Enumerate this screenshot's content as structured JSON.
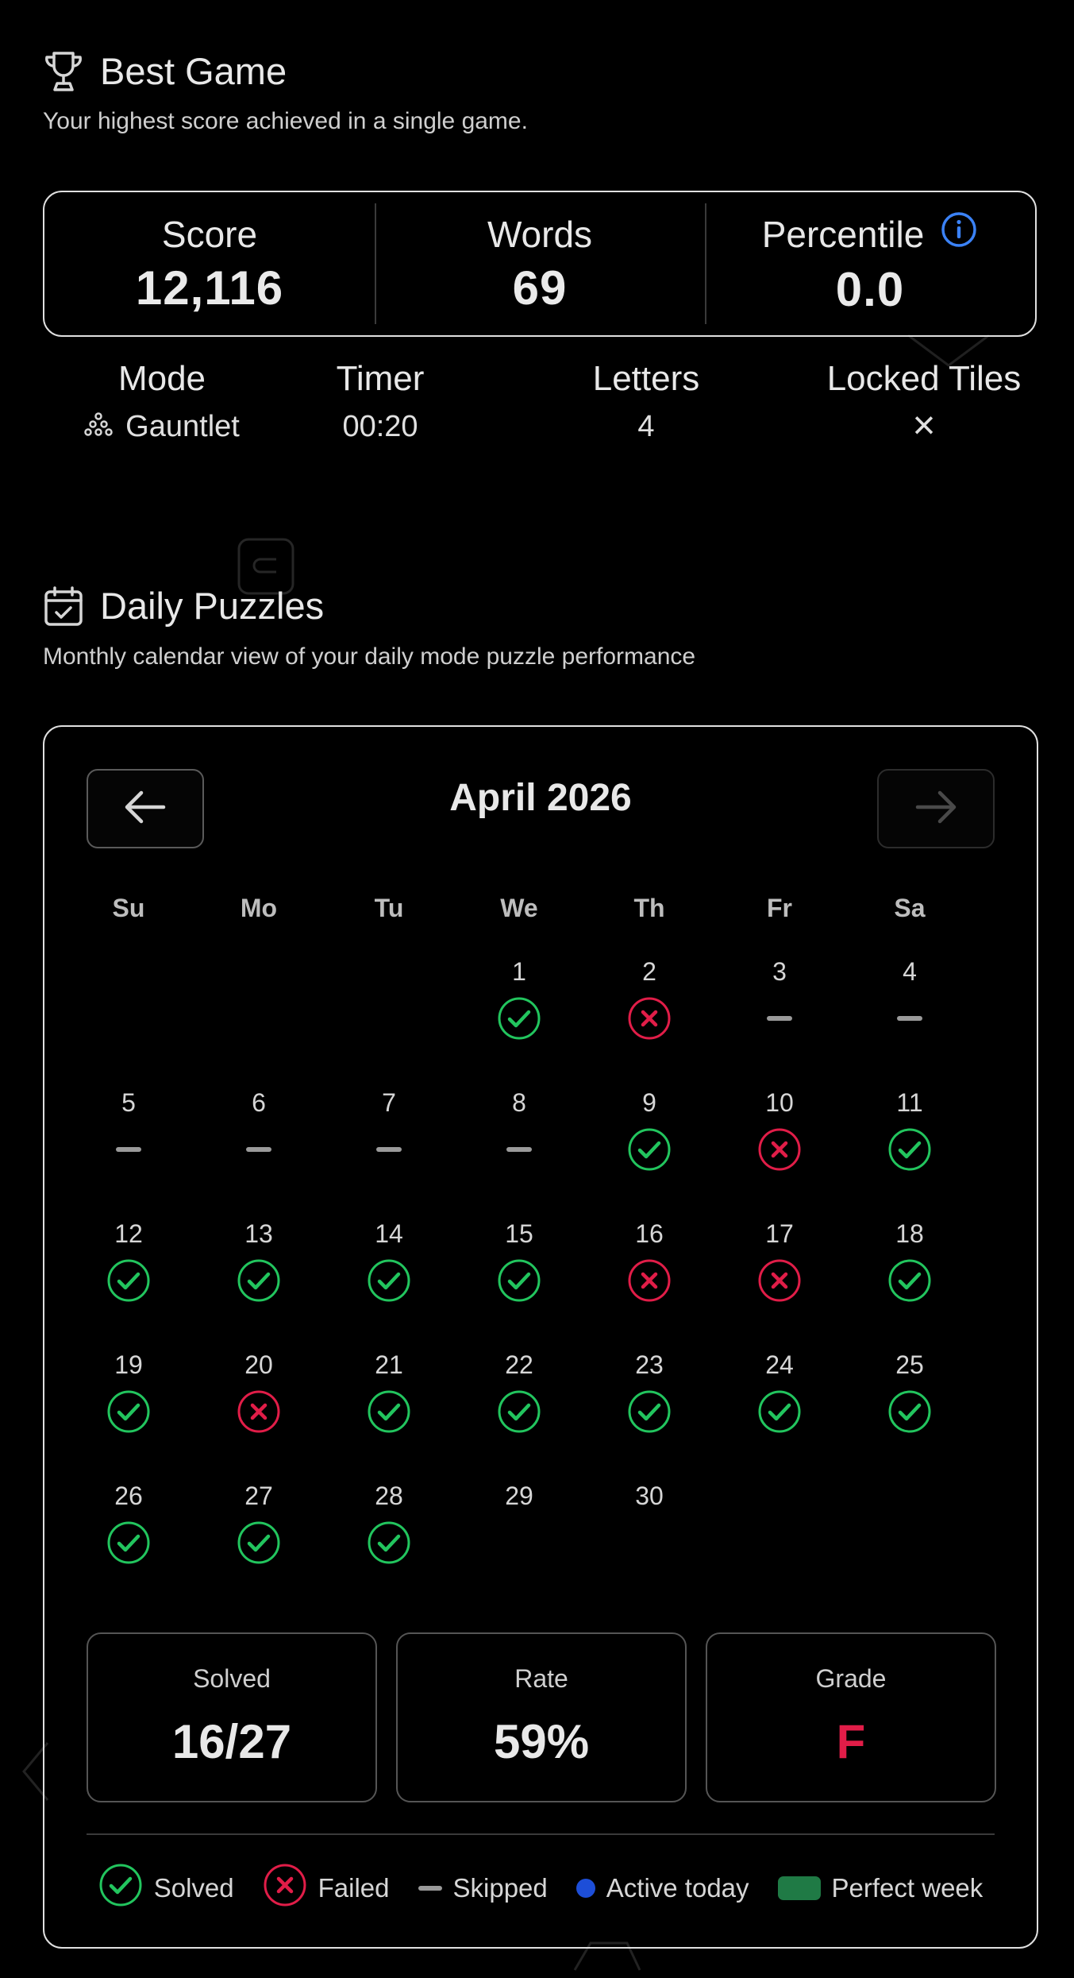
{
  "best_game": {
    "title": "Best Game",
    "subtitle": "Your highest score achieved in a single game.",
    "stats": [
      {
        "label": "Score",
        "value": "12,116"
      },
      {
        "label": "Words",
        "value": "69"
      },
      {
        "label": "Percentile",
        "value": "0.0"
      }
    ],
    "meta": [
      {
        "label": "Mode",
        "value": "Gauntlet"
      },
      {
        "label": "Timer",
        "value": "00:20"
      },
      {
        "label": "Letters",
        "value": "4"
      },
      {
        "label": "Locked Tiles",
        "value": "×"
      }
    ]
  },
  "daily": {
    "title": "Daily Puzzles",
    "subtitle": "Monthly calendar view of your daily mode puzzle performance",
    "month": "April 2026",
    "weekdays": [
      "Su",
      "Mo",
      "Tu",
      "We",
      "Th",
      "Fr",
      "Sa"
    ],
    "first_weekday_index": 3,
    "days": [
      {
        "day": "1",
        "status": "solved"
      },
      {
        "day": "2",
        "status": "failed"
      },
      {
        "day": "3",
        "status": "skipped"
      },
      {
        "day": "4",
        "status": "skipped"
      },
      {
        "day": "5",
        "status": "skipped"
      },
      {
        "day": "6",
        "status": "skipped"
      },
      {
        "day": "7",
        "status": "skipped"
      },
      {
        "day": "8",
        "status": "skipped"
      },
      {
        "day": "9",
        "status": "solved"
      },
      {
        "day": "10",
        "status": "failed"
      },
      {
        "day": "11",
        "status": "solved"
      },
      {
        "day": "12",
        "status": "solved"
      },
      {
        "day": "13",
        "status": "solved"
      },
      {
        "day": "14",
        "status": "solved"
      },
      {
        "day": "15",
        "status": "solved"
      },
      {
        "day": "16",
        "status": "failed"
      },
      {
        "day": "17",
        "status": "failed"
      },
      {
        "day": "18",
        "status": "solved"
      },
      {
        "day": "19",
        "status": "solved"
      },
      {
        "day": "20",
        "status": "failed"
      },
      {
        "day": "21",
        "status": "solved"
      },
      {
        "day": "22",
        "status": "solved"
      },
      {
        "day": "23",
        "status": "solved"
      },
      {
        "day": "24",
        "status": "solved"
      },
      {
        "day": "25",
        "status": "solved"
      },
      {
        "day": "26",
        "status": "solved"
      },
      {
        "day": "27",
        "status": "solved"
      },
      {
        "day": "28",
        "status": "solved"
      },
      {
        "day": "29",
        "status": "none"
      },
      {
        "day": "30",
        "status": "none"
      }
    ],
    "summary": [
      {
        "label": "Solved",
        "value": "16/27"
      },
      {
        "label": "Rate",
        "value": "59%"
      },
      {
        "label": "Grade",
        "value": "F"
      }
    ],
    "legend": [
      {
        "label": "Solved",
        "icon": "check-circle-icon"
      },
      {
        "label": "Failed",
        "icon": "x-circle-icon"
      },
      {
        "label": "Skipped",
        "icon": "dash-icon"
      },
      {
        "label": "Active today",
        "icon": "blue-dot-icon"
      },
      {
        "label": "Perfect week",
        "icon": "green-rect-icon"
      }
    ]
  },
  "colors": {
    "solved": "#22c55e",
    "failed": "#e11d48",
    "skipped": "#9a9a9a",
    "active": "#1d4ed8",
    "perfect": "#1f7a45",
    "info": "#3b82f6"
  }
}
